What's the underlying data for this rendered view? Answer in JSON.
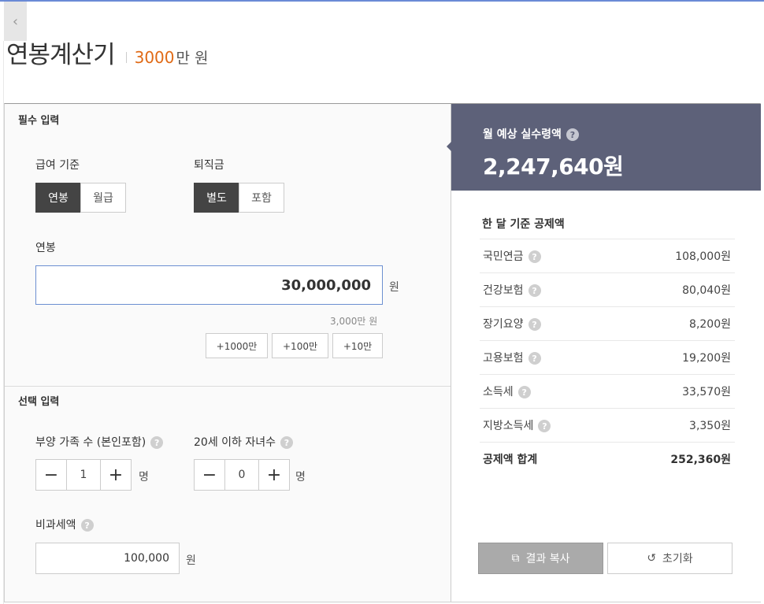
{
  "header": {
    "back_icon": "chevron-left-icon",
    "title": "연봉계산기",
    "salary_value": "3000",
    "salary_unit": "만 원"
  },
  "required": {
    "section_title": "필수 입력",
    "pay_basis": {
      "label": "급여 기준",
      "options": [
        "연봉",
        "월급"
      ],
      "selected": "연봉"
    },
    "severance": {
      "label": "퇴직금",
      "options": [
        "별도",
        "포함"
      ],
      "selected": "별도"
    },
    "salary": {
      "label": "연봉",
      "value": "30,000,000",
      "unit": "원",
      "helper": "3,000만 원",
      "quick_buttons": [
        "+1000만",
        "+100만",
        "+10만"
      ]
    }
  },
  "optional": {
    "section_title": "선택 입력",
    "dependents": {
      "label": "부양 가족 수 (본인포함)",
      "value": "1",
      "unit": "명"
    },
    "children": {
      "label": "20세 이하 자녀수",
      "value": "0",
      "unit": "명"
    },
    "nontaxable": {
      "label": "비과세액",
      "value": "100,000",
      "unit": "원"
    }
  },
  "result": {
    "label": "월 예상 실수령액",
    "amount": "2,247,640원",
    "deduction_title": "한 달 기준 공제액",
    "deductions": [
      {
        "name": "국민연금",
        "value": "108,000원"
      },
      {
        "name": "건강보험",
        "value": "80,040원"
      },
      {
        "name": "장기요양",
        "value": "8,200원"
      },
      {
        "name": "고용보험",
        "value": "19,200원"
      },
      {
        "name": "소득세",
        "value": "33,570원"
      },
      {
        "name": "지방소득세",
        "value": "3,350원"
      }
    ],
    "total": {
      "name": "공제액 합계",
      "value": "252,360원"
    },
    "copy_button": "결과 복사",
    "reset_button": "초기화"
  },
  "help_mark": "?",
  "colors": {
    "accent_orange": "#e06a16",
    "result_header": "#5d6179",
    "selected_segment": "#444444",
    "input_focus": "#6c8fd1"
  }
}
